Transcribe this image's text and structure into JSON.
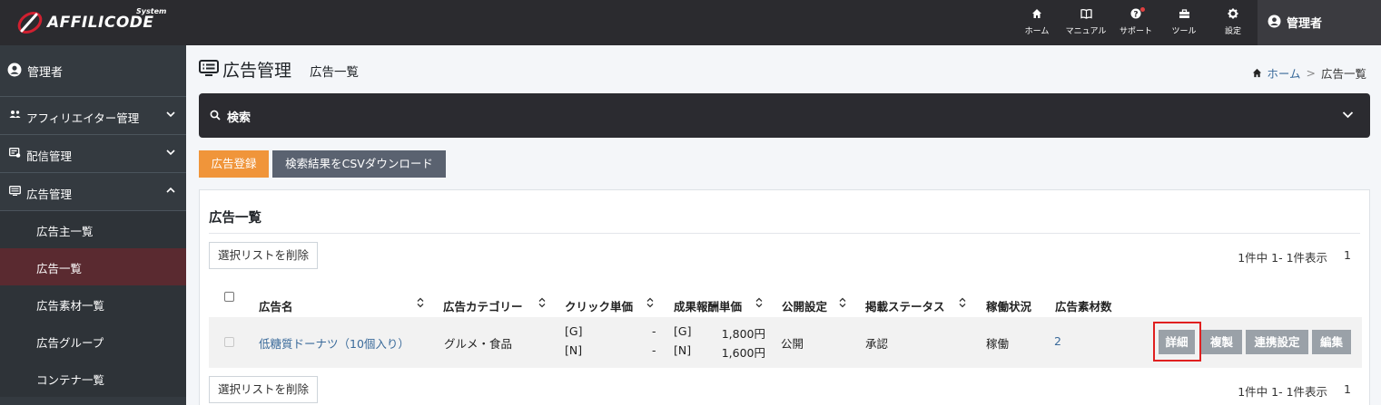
{
  "brand": {
    "name": "AFFILICODE",
    "tag": "System"
  },
  "topnav": [
    {
      "label": "ホーム",
      "icon": "home-icon"
    },
    {
      "label": "マニュアル",
      "icon": "book-icon"
    },
    {
      "label": "サポート",
      "icon": "question-icon"
    },
    {
      "label": "ツール",
      "icon": "toolbox-icon"
    },
    {
      "label": "設定",
      "icon": "gear-icon"
    }
  ],
  "user": {
    "name": "管理者"
  },
  "sidebar": {
    "user_label": "管理者",
    "items": [
      {
        "label": "アフィリエイター管理",
        "icon": "users-icon"
      },
      {
        "label": "配信管理",
        "icon": "delivery-icon"
      },
      {
        "label": "広告管理",
        "icon": "ad-list-icon"
      }
    ],
    "sub_items": [
      "広告主一覧",
      "広告一覧",
      "広告素材一覧",
      "広告グループ",
      "コンテナ一覧"
    ]
  },
  "page": {
    "title": "広告管理",
    "subtitle": "広告一覧",
    "breadcrumb_home": "ホーム",
    "breadcrumb_sep": ">",
    "breadcrumb_current": "広告一覧"
  },
  "search": {
    "label": "検索"
  },
  "actions": {
    "register": "広告登録",
    "csv": "検索結果をCSVダウンロード"
  },
  "list": {
    "title": "広告一覧",
    "delete_selected": "選択リストを削除",
    "pager_info": "1件中 1- 1件表示",
    "pager_page": "1",
    "columns": [
      "広告名",
      "広告カテゴリー",
      "クリック単価",
      "成果報酬単価",
      "公開設定",
      "掲載ステータス",
      "稼働状況",
      "広告素材数"
    ],
    "rows": [
      {
        "name": "低糖質ドーナツ（10個入り）",
        "category": "グルメ・食品",
        "click_g_label": "[G]",
        "click_g_value": "-",
        "click_n_label": "[N]",
        "click_n_value": "-",
        "reward_g_label": "[G]",
        "reward_g_value": "1,800円",
        "reward_n_label": "[N]",
        "reward_n_value": "1,600円",
        "publish": "公開",
        "status": "承認",
        "operation": "稼働",
        "materials": "2",
        "buttons": {
          "detail": "詳細",
          "copy": "複製",
          "link": "連携設定",
          "edit": "編集"
        }
      }
    ]
  }
}
